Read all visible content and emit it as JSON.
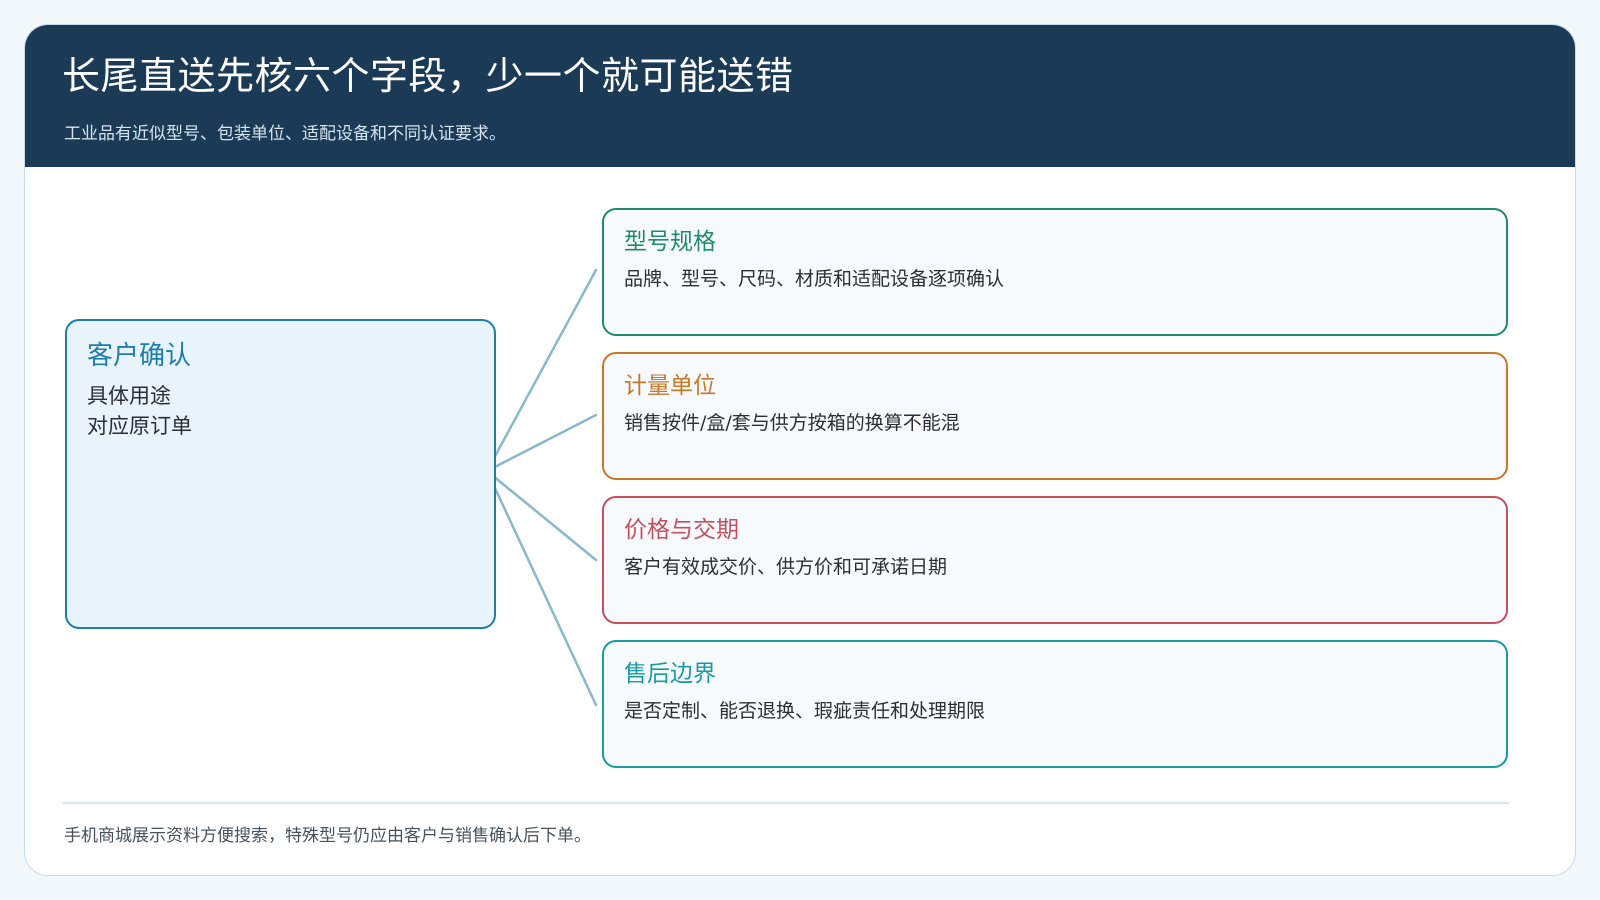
{
  "header": {
    "title": "长尾直送先核六个字段，少一个就可能送错",
    "subtitle": "工业品有近似型号、包装单位、适配设备和不同认证要求。"
  },
  "source": {
    "title": "客户确认",
    "lines": [
      "具体用途",
      "对应原订单"
    ],
    "color": "#1b7fad"
  },
  "fields": [
    {
      "title": "型号规格",
      "desc": "品牌、型号、尺码、材质和适配设备逐项确认",
      "color": "#1f8a6e"
    },
    {
      "title": "计量单位",
      "desc": "销售按件/盒/套与供方按箱的换算不能混",
      "color": "#c8782a"
    },
    {
      "title": "价格与交期",
      "desc": "客户有效成交价、供方价和可承诺日期",
      "color": "#c4505d"
    },
    {
      "title": "售后边界",
      "desc": "是否定制、能否退换、瑕疵责任和处理期限",
      "color": "#1a9aa6"
    }
  ],
  "connector_color": "#8ab8cc",
  "footer": {
    "note": "手机商城展示资料方便搜索，特殊型号仍应由客户与销售确认后下单。"
  }
}
